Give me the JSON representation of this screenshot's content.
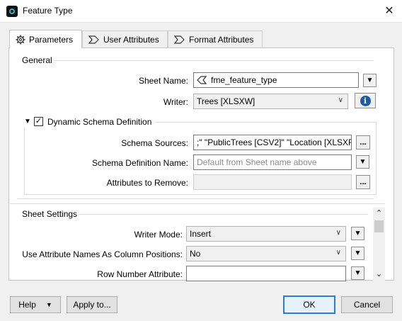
{
  "window": {
    "title": "Feature Type",
    "close_glyph": "✕"
  },
  "tabs": [
    {
      "label": "Parameters",
      "icon": "gear-icon"
    },
    {
      "label": "User Attributes",
      "icon": "attribute-arrow-icon"
    },
    {
      "label": "Format Attributes",
      "icon": "attribute-arrow-icon"
    }
  ],
  "general": {
    "title": "General",
    "sheet_name_label": "Sheet Name:",
    "sheet_name_value": "fme_feature_type",
    "writer_label": "Writer:",
    "writer_value": "Trees [XLSXW]",
    "dynamic_schema_label": "Dynamic Schema Definition",
    "dynamic_schema_checked": true,
    "schema_sources_label": "Schema Sources:",
    "schema_sources_value": ";\" \"PublicTrees [CSV2]\" \"Location [XLSXR]\"",
    "schema_def_name_label": "Schema Definition Name:",
    "schema_def_name_placeholder": "Default from Sheet name above",
    "attrs_remove_label": "Attributes to Remove:",
    "attrs_remove_value": ""
  },
  "sheet_settings": {
    "title": "Sheet Settings",
    "writer_mode_label": "Writer Mode:",
    "writer_mode_value": "Insert",
    "use_attr_names_label": "Use Attribute Names As Column Positions:",
    "use_attr_names_value": "No",
    "row_number_label": "Row Number Attribute:",
    "row_number_value": ""
  },
  "glyphs": {
    "dropdown": "▼",
    "chevron": "∨",
    "ellipsis": "...",
    "info": "i",
    "check": "✓",
    "collapse": "▼",
    "scroll_up": "⌃",
    "scroll_down": "⌄"
  },
  "footer": {
    "help_label": "Help",
    "help_arrow": "▼",
    "apply_label": "Apply to...",
    "ok_label": "OK",
    "cancel_label": "Cancel"
  },
  "colors": {
    "accent": "#2c7bd6",
    "info_blue": "#1e5aa8",
    "app_icon_ring": "#2bb3c9"
  }
}
